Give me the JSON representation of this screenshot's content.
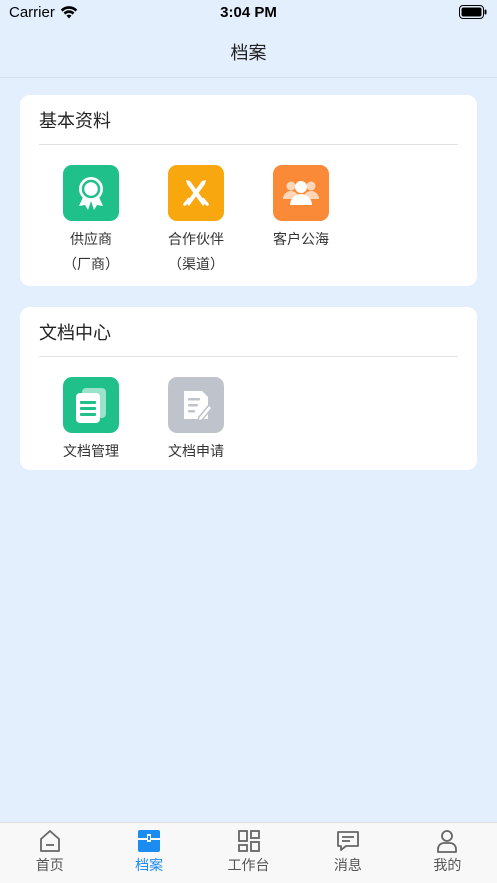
{
  "status_bar": {
    "carrier": "Carrier",
    "time": "3:04 PM"
  },
  "nav": {
    "title": "档案"
  },
  "sections": [
    {
      "title": "基本资料",
      "items": [
        {
          "label": "供应商",
          "sublabel": "（厂商）",
          "icon": "award-badge-icon",
          "color": "#1fc08a"
        },
        {
          "label": "合作伙伴",
          "sublabel": "（渠道）",
          "icon": "handshake-swords-icon",
          "color": "#f9a70e"
        },
        {
          "label": "客户公海",
          "icon": "customer-group-icon",
          "color": "#fa8a37"
        }
      ]
    },
    {
      "title": "文档中心",
      "items": [
        {
          "label": "文档管理",
          "icon": "documents-stack-icon",
          "color": "#1fc08a"
        },
        {
          "label": "文档申请",
          "icon": "document-edit-icon",
          "color": "#bfc4cc"
        }
      ]
    }
  ],
  "tabbar": {
    "active_color": "#1b8cf0",
    "tabs": [
      {
        "label": "首页",
        "icon": "home-icon"
      },
      {
        "label": "档案",
        "icon": "archive-icon",
        "active": true
      },
      {
        "label": "工作台",
        "icon": "dashboard-grid-icon"
      },
      {
        "label": "消息",
        "icon": "message-icon"
      },
      {
        "label": "我的",
        "icon": "user-icon"
      }
    ]
  }
}
